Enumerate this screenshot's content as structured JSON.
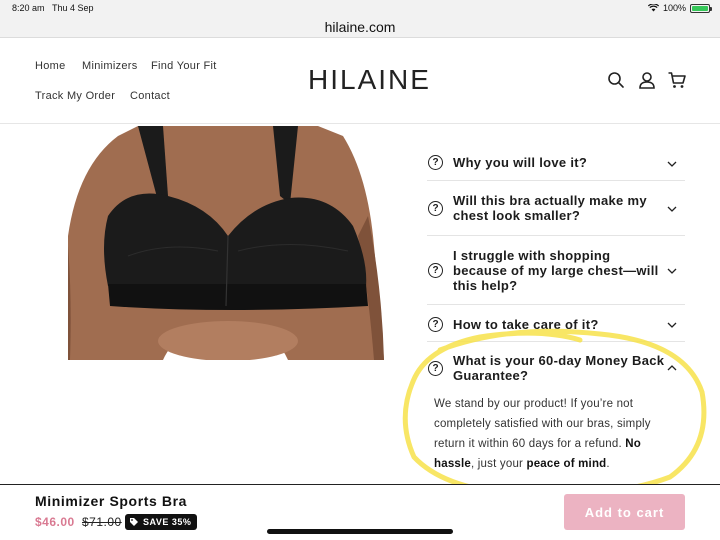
{
  "status_bar": {
    "time": "8:20 am",
    "date": "Thu 4 Sep",
    "battery": "100%",
    "icons": [
      "wifi-icon",
      "battery-icon"
    ]
  },
  "browser": {
    "url": "hilaine.com"
  },
  "header": {
    "nav": [
      "Home",
      "Minimizers",
      "Find Your Fit",
      "Track My Order",
      "Contact"
    ],
    "logo": "HILAINE",
    "icons": [
      "search-icon",
      "account-icon",
      "cart-icon"
    ]
  },
  "product_image": {
    "subject": "black minimizer bra on model",
    "bra_color": "#1b1b1b",
    "skin_color": "#9c6a4e"
  },
  "faq": {
    "items": [
      {
        "question": "Why you will love it?",
        "expanded": false
      },
      {
        "question": "Will this bra actually make my chest look smaller?",
        "expanded": false
      },
      {
        "question": "I struggle with shopping because of my large chest—will this help?",
        "expanded": false
      },
      {
        "question": "How to take care of it?",
        "expanded": false
      },
      {
        "question": "What is your 60-day Money Back Guarantee?",
        "expanded": true
      }
    ],
    "answer": {
      "text": "We stand by our product! If you’re not completely satisfied with our bras, simply return it within 60 days for a refund.",
      "bold1": "No hassle",
      "mid": ", just your ",
      "bold2": "peace of mind",
      "end": "."
    }
  },
  "sticky_bar": {
    "title": "Minimizer Sports Bra",
    "price": "$46.00",
    "compare_price": "$71.00",
    "badge": "SAVE 35%",
    "add_to_cart": "Add to cart"
  },
  "colors": {
    "accent_pink": "#ecb3c2",
    "price_pink": "#d97a92",
    "highlight_yellow": "#f7e24a"
  }
}
